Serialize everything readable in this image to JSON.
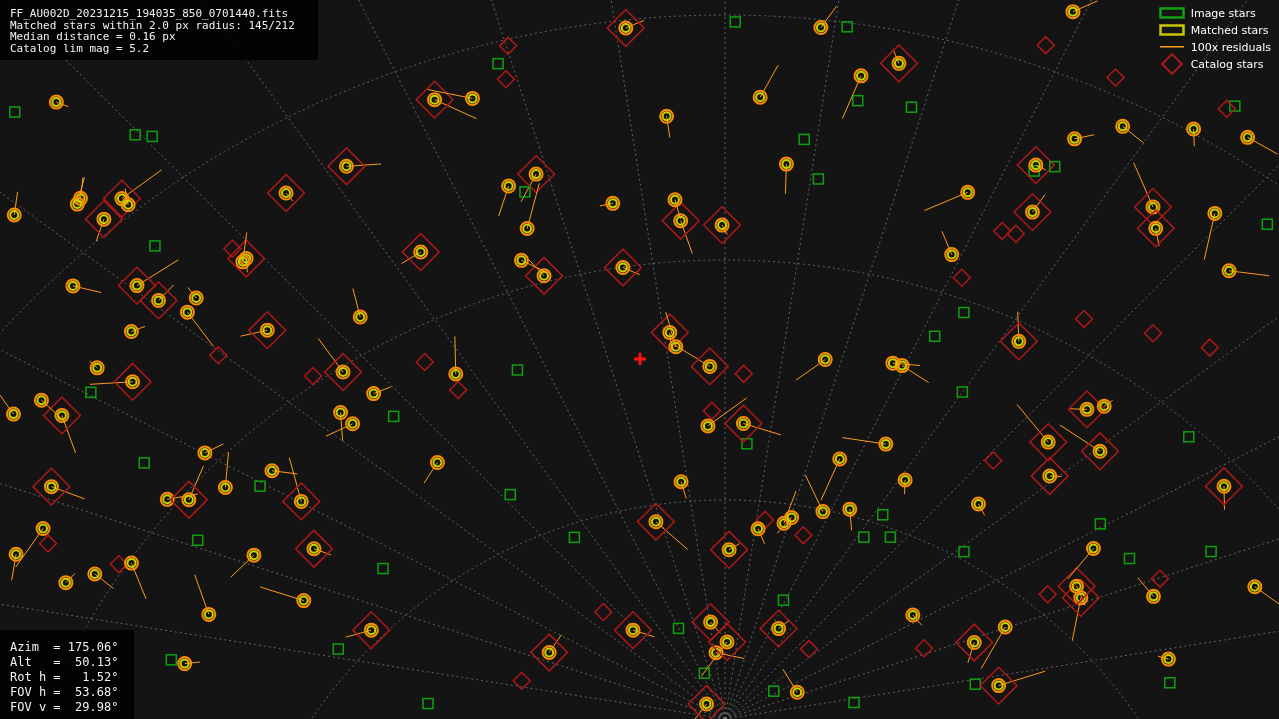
{
  "info": {
    "lines": [
      "FF_AU002D_20231215_194035_850_0701440.fits",
      "Matched stars within 2.0 px radius: 145/212",
      "Median distance = 0.16 px",
      "Catalog lim mag = 5.2"
    ]
  },
  "legend": [
    {
      "kind": "image",
      "label": "Image stars"
    },
    {
      "kind": "matched",
      "label": "Matched stars"
    },
    {
      "kind": "residual",
      "label": "100x residuals"
    },
    {
      "kind": "catalog",
      "label": "Catalog stars"
    }
  ],
  "pointing": {
    "lines": [
      "Azim  = 175.06°",
      "Alt   =  50.13°",
      "Rot h =   1.52°",
      "FOV h =  53.68°",
      "FOV v =  29.98°"
    ]
  }
}
